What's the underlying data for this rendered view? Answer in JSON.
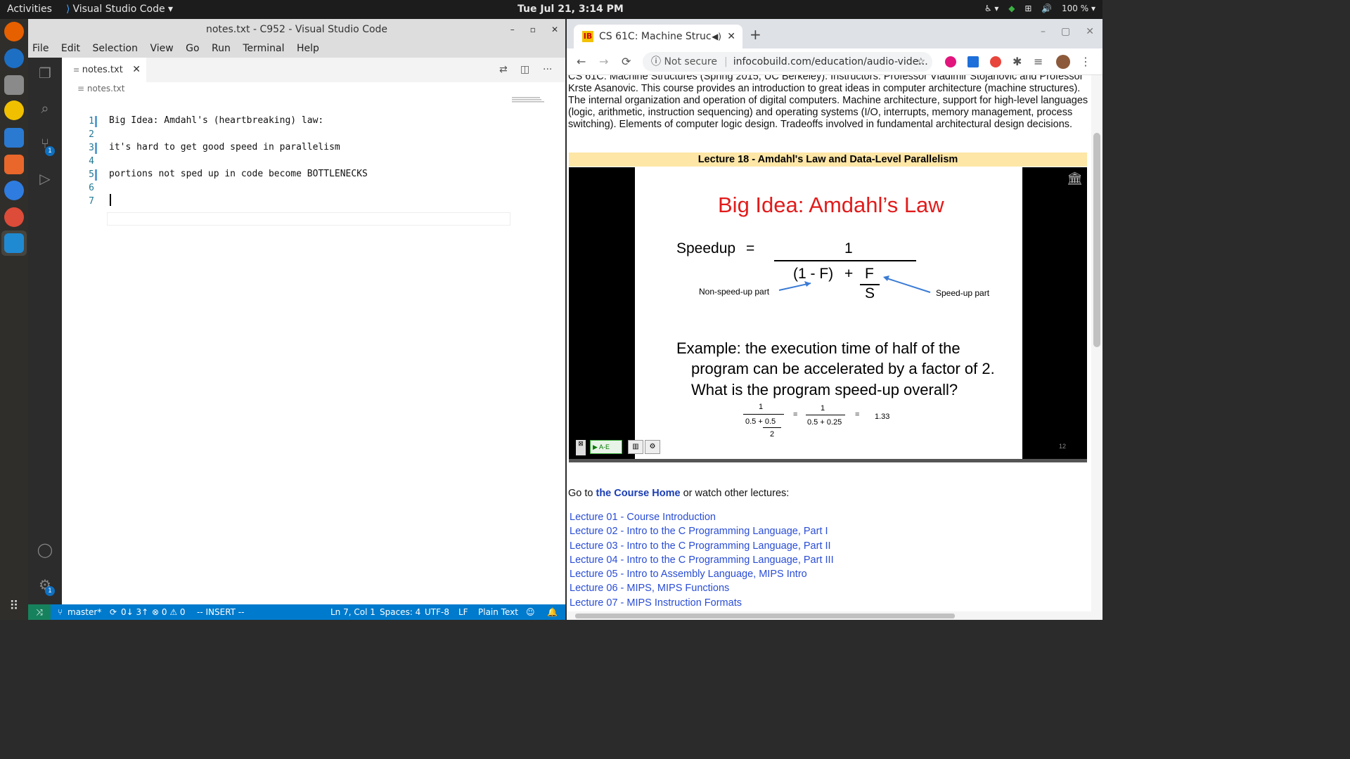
{
  "topbar": {
    "activities": "Activities",
    "app_name": "Visual Studio Code",
    "clock": "Tue Jul 21,  3:14 PM",
    "battery": "100 %"
  },
  "vscode": {
    "title": "notes.txt - C952 - Visual Studio Code",
    "menu": [
      "File",
      "Edit",
      "Selection",
      "View",
      "Go",
      "Run",
      "Terminal",
      "Help"
    ],
    "tab_label": "notes.txt",
    "breadcrumb": "notes.txt",
    "line_numbers": [
      "1",
      "2",
      "3",
      "4",
      "5",
      "6",
      "7"
    ],
    "lines": [
      "Big Idea: Amdahl's (heartbreaking) law:",
      "",
      "it's hard to get good speed in parallelism",
      "",
      "portions not sped up in code become BOTTLENECKS",
      "",
      ""
    ],
    "scm_badge": "1",
    "settings_badge": "1",
    "status": {
      "branch": "master*",
      "sync": "0↓ 3↑",
      "problems": "⊗ 0 ⚠ 0",
      "mode": "-- INSERT --",
      "position": "Ln 7, Col 1",
      "spaces": "Spaces: 4",
      "encoding": "UTF-8",
      "eol": "LF",
      "language": "Plain Text"
    }
  },
  "chrome": {
    "tab_title": "CS 61C: Machine Struc",
    "not_secure": "Not secure",
    "url": "infocobuild.com/education/audio-vide...",
    "description": "CS 61C: Machine Structures (Spring 2015, UC Berkeley). Instructors: Professor Vladimir Stojanovic and Professor Krste Asanovic. This course provides an introduction to great ideas in computer architecture (machine structures). The internal organization and operation of digital computers. Machine architecture, support for high-level languages (logic, arithmetic, instruction sequencing) and operating systems (I/O, interrupts, memory management, process switching). Elements of computer logic design. Tradeoffs involved in fundamental architectural design decisions.",
    "lecture_heading": "Lecture 18 - Amdahl's Law and Data-Level Parallelism",
    "slide": {
      "title": "Big Idea: Amdahl’s Law",
      "speedup": "Speedup",
      "equals": "=",
      "numerator": "1",
      "denominator_left": "(1 - F)",
      "plus": "+",
      "f": "F",
      "s": "S",
      "non_speed": "Non-speed-up part",
      "speed": "Speed-up part",
      "example_1": "Example: the execution time of half of the",
      "example_2": "program can be accelerated by a factor of 2.",
      "example_3": "What is the program speed-up overall?",
      "calc_num1": "1",
      "calc_den1": "0.5 + 0.5",
      "calc_den1b": "2",
      "calc_eq1": "=",
      "calc_num2": "1",
      "calc_den2": "0.5 + 0.25",
      "calc_eq2": "=",
      "calc_result": "1.33",
      "page_number": "12",
      "ae_label": "A-E"
    },
    "goto_prefix": "Go to ",
    "goto_link": "the Course Home",
    "goto_suffix": " or watch other lectures:",
    "lectures": [
      "Lecture 01 - Course Introduction",
      "Lecture 02 - Intro to the C Programming Language, Part I",
      "Lecture 03 - Intro to the C Programming Language, Part II",
      "Lecture 04 - Intro to the C Programming Language, Part III",
      "Lecture 05 - Intro to Assembly Language, MIPS Intro",
      "Lecture 06 - MIPS, MIPS Functions",
      "Lecture 07 - MIPS Instruction Formats"
    ]
  }
}
